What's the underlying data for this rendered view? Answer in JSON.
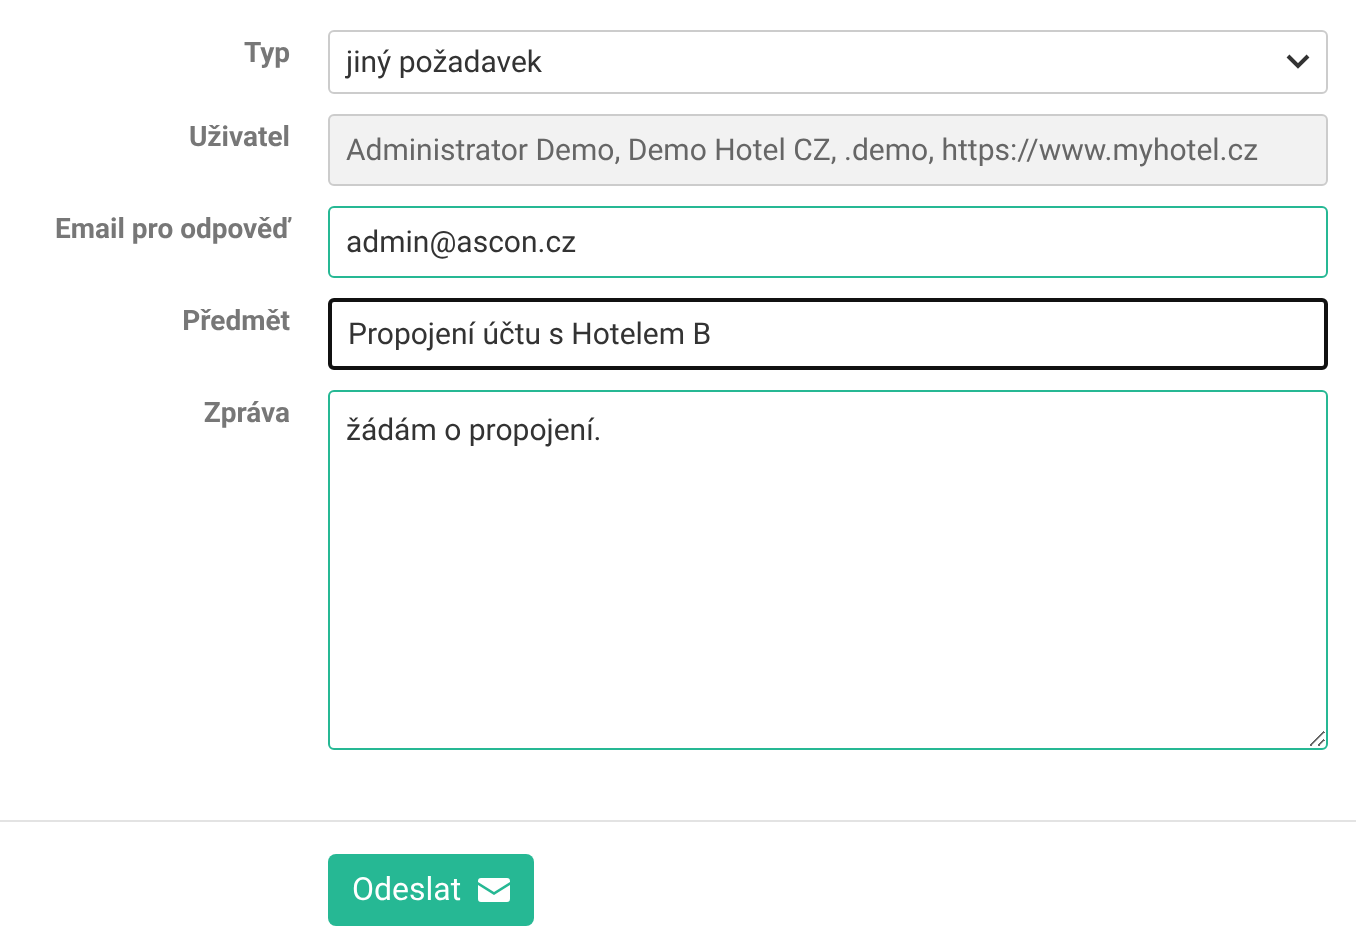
{
  "fields": [
    {
      "label": "Typ",
      "kind": "select",
      "value": "jiný požadavek",
      "valid": false,
      "focused": false
    },
    {
      "label": "Uživatel",
      "kind": "readonly",
      "value": "Administrator Demo, Demo Hotel CZ, .demo, https://www.myhotel.cz",
      "valid": false,
      "focused": false
    },
    {
      "label": "Email pro odpověď",
      "kind": "input",
      "value": "admin@ascon.cz",
      "valid": true,
      "focused": false
    },
    {
      "label": "Předmět",
      "kind": "input",
      "value": "Propojení účtu s Hotelem B",
      "focused": true
    },
    {
      "label": "Zpráva",
      "kind": "textarea",
      "value": "žádám o propojení.",
      "valid": true,
      "focused": false
    }
  ],
  "submit": {
    "label": "Odeslat"
  }
}
